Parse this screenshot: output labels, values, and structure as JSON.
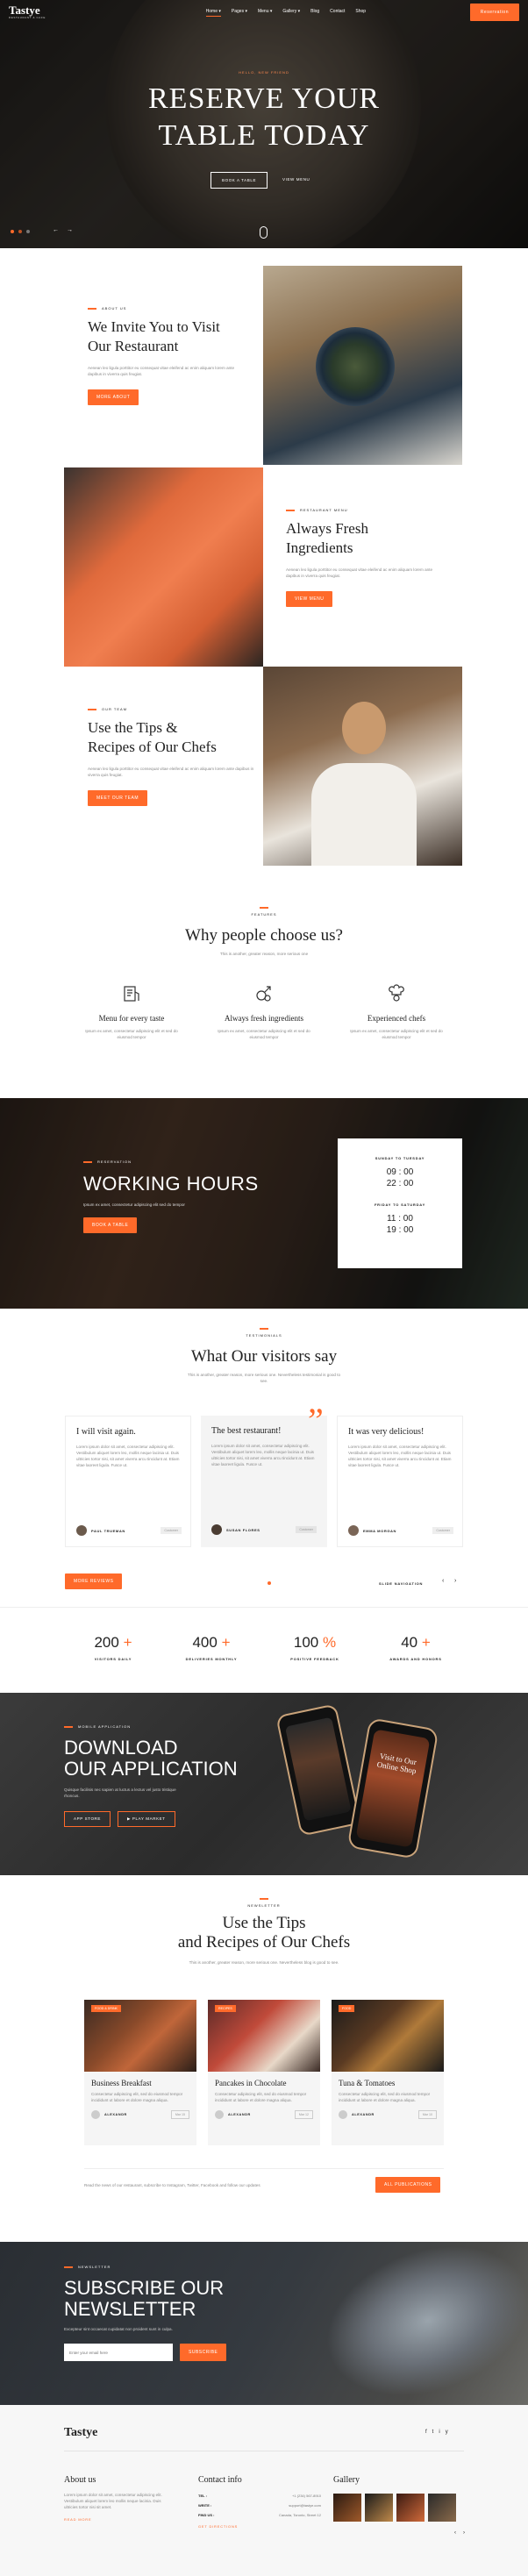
{
  "brand": {
    "name": "Tastye",
    "tagline": "RESTAURANT & CAFE"
  },
  "nav": {
    "items": [
      {
        "label": "Home",
        "caret": true
      },
      {
        "label": "Pages",
        "caret": true
      },
      {
        "label": "Menu",
        "caret": true
      },
      {
        "label": "Gallery",
        "caret": true
      },
      {
        "label": "Blog",
        "caret": false
      },
      {
        "label": "Contact",
        "caret": false
      },
      {
        "label": "Shop",
        "caret": false
      }
    ],
    "cta": "Reservation"
  },
  "hero": {
    "kicker": "HELLO, NEW FRIEND",
    "title_line1": "RESERVE YOUR",
    "title_line2": "TABLE TODAY",
    "primary_btn": "BOOK A TABLE",
    "secondary_btn": "VIEW MENU"
  },
  "invite": {
    "kicker": "ABOUT US",
    "title_line1": "We Invite You to Visit",
    "title_line2": "Our Restaurant",
    "text": "Aenean leo ligula porttitor eu consequat vitae eleifend ac enim aliquam lorem ante dapibus in viverra quis feugiat.",
    "btn": "MORE ABOUT"
  },
  "fresh": {
    "kicker": "RESTAURANT MENU",
    "title_line1": "Always Fresh",
    "title_line2": "Ingredients",
    "text": "Aenean leo ligula porttitor eu consequat vitae eleifend ac enim aliquam lorem ante dapibus in viverra quis feugiat.",
    "btn": "VIEW MENU"
  },
  "tips": {
    "kicker": "OUR TEAM",
    "title_line1": "Use the Tips &",
    "title_line2": "Recipes of Our Chefs",
    "text": "Aenean leo ligula porttitor eu consequat vitae eleifend ac enim aliquam lorem ante dapibus in viverra quis feugiat.",
    "btn": "MEET OUR TEAM"
  },
  "why": {
    "kicker": "FEATURES",
    "title": "Why people choose us?",
    "subtitle": "This is another, greater reason, more serious one",
    "features": [
      {
        "icon": "menu-board-icon",
        "title": "Menu for every taste",
        "text": "Ipsum ex amet, consectetur adipiscing elit et sed do eiusmod tempor"
      },
      {
        "icon": "ingredients-icon",
        "title": "Always fresh ingredients",
        "text": "Ipsum ex amet, consectetur adipiscing elit et sed do eiusmod tempor"
      },
      {
        "icon": "chef-icon",
        "title": "Experienced chefs",
        "text": "Ipsum ex amet, consectetur adipiscing elit et sed do eiusmod tempor"
      }
    ]
  },
  "hours": {
    "kicker": "RESERVATION",
    "title": "WORKING HOURS",
    "text": "Ipsum ex amet, consectetur adipiscing elit sed do tempor",
    "btn": "BOOK A TABLE",
    "card": [
      {
        "label": "SUNDAY TO TUESDAY",
        "open": "09 : 00",
        "close": "22 : 00"
      },
      {
        "label": "FRIDAY TO SATURDAY",
        "open": "11 : 00",
        "close": "19 : 00"
      }
    ]
  },
  "testimonials": {
    "kicker": "TESTIMONIALS",
    "title": "What Our visitors say",
    "subtitle": "This is another, greater reason, more serious one. Nevertheless testimonial is good to see.",
    "items": [
      {
        "title": "I will visit again.",
        "text": "Lorem ipsum dolor sit amet, consectetur adipiscing elit. Vestibulum aliquet lorem leo, mollis neque lacinia ut. Duis ultricies tortor nisi, sit amet viverra arcu tincidunt at. Etiam vitae laoreet ligula. Fusce ut.",
        "name": "PAUL TRUEMAN",
        "tag": "Customer"
      },
      {
        "title": "The best restaurant!",
        "text": "Lorem ipsum dolor sit amet, consectetur adipiscing elit. Vestibulum aliquet lorem leo, mollis neque lacinia ut. Duis ultricies tortor nisi, sit amet viverra arcu tincidunt at. Etiam vitae laoreet ligula. Fusce ut.",
        "name": "SUSAN FLORES",
        "tag": "Customer"
      },
      {
        "title": "It was very delicious!",
        "text": "Lorem ipsum dolor sit amet, consectetur adipiscing elit. Vestibulum aliquet lorem leo, mollis neque lacinia ut. Duis ultricies tortor nisi, sit amet viverra arcu tincidunt at. Etiam vitae laoreet ligula. Fusce ut.",
        "name": "EMMA MORGAN",
        "tag": "Customer"
      }
    ],
    "btn": "MORE REVIEWS",
    "nav_label": "SLIDE NAVIGATION"
  },
  "stats": [
    {
      "value": "200",
      "suffix": "+",
      "label": "VISITORS DAILY"
    },
    {
      "value": "400",
      "suffix": "+",
      "label": "DELIVERIES MONTHLY"
    },
    {
      "value": "100",
      "suffix": "%",
      "label": "POSITIVE FEEDBACK"
    },
    {
      "value": "40",
      "suffix": "+",
      "label": "AWARDS AND HONORS"
    }
  ],
  "app": {
    "kicker": "MOBILE APPLICATION",
    "title_line1": "DOWNLOAD",
    "title_line2": "OUR APPLICATION",
    "text": "Quisque facilisis nec sapien at luctus a lectus vel justo tristique rhoncus.",
    "appstore": "APP STORE",
    "playstore": "PLAY MARKET",
    "phone_text_line1": "Visit to Our",
    "phone_text_line2": "Online Shop"
  },
  "news": {
    "kicker": "NEWSLETTER",
    "title_line1": "Use the Tips",
    "title_line2": "and Recipes of Our Chefs",
    "subtitle": "This is another, greater reason, more serious one. Nevertheless blog is good to see.",
    "posts": [
      {
        "tag": "FOOD & DRINK",
        "title": "Business Breakfast",
        "text": "Consectetur adipiscing elit, sed do eiusmod tempor incididunt ut labore et dolore magna aliqua.",
        "author": "ALEXANDR",
        "meta": "Mar 15"
      },
      {
        "tag": "RECIPES",
        "title": "Pancakes in Chocolate",
        "text": "Consectetur adipiscing elit, sed do eiusmod tempor incididunt ut labore et dolore magna aliqua.",
        "author": "ALEXANDR",
        "meta": "Mar 12"
      },
      {
        "tag": "FOOD",
        "title": "Tuna & Tomatoes",
        "text": "Consectetur adipiscing elit, sed do eiusmod tempor incididunt ut labore et dolore magna aliqua.",
        "author": "ALEXANDR",
        "meta": "Mar 10"
      }
    ],
    "footer_text": "Read the news of our restaurant, subscribe to Instagram, Twitter, Facebook and follow our updates",
    "btn": "ALL PUBLICATIONS"
  },
  "subscribe": {
    "kicker": "NEWSLETTER",
    "title_line1": "SUBSCRIBE OUR",
    "title_line2": "NEWSLETTER",
    "text": "Excepteur sint occaecat cupidatat non proident sunt in culpa.",
    "placeholder": "Enter your email here",
    "btn": "SUBSCRIBE"
  },
  "footer": {
    "brand": "Tastye",
    "social": [
      "f",
      "t",
      "i",
      "y"
    ],
    "about_title": "About us",
    "about_text": "Lorem ipsum dolor sit amet, consectetur adipiscing elit. Vestibulum aliquet lorem leo mollis neque lacinia. Duis ultricies tortor nisi sit amet.",
    "about_link": "READ MORE",
    "contact_title": "Contact info",
    "contacts": [
      {
        "label": "TEL :",
        "value": "+1 (234) 567-8910"
      },
      {
        "label": "WRITE :",
        "value": "support@tastye.com"
      },
      {
        "label": "FIND US :",
        "value": "Canada, Toronto, Street 12"
      }
    ],
    "contact_link": "GET DIRECTIONS",
    "gallery_title": "Gallery"
  }
}
